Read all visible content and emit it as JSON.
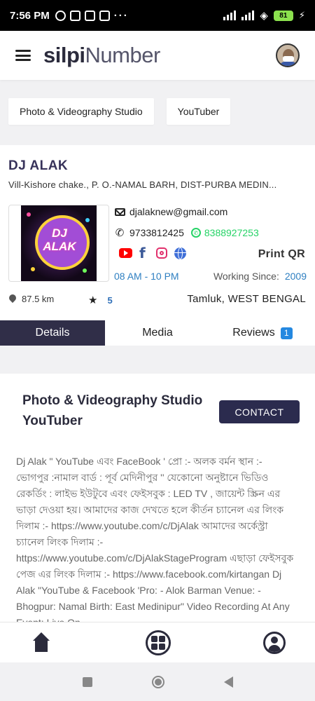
{
  "status_bar": {
    "time": "7:56 PM",
    "more": "···",
    "battery": "81"
  },
  "header": {
    "logo_bold": "silpi",
    "logo_light": "Number"
  },
  "categories": [
    "Photo & Videography Studio",
    "YouTuber"
  ],
  "profile": {
    "name": "DJ ALAK",
    "address": "Vill-Kishore chake., P. O.-NAMAL BARH, DIST-PURBA MEDIN",
    "logo_text": "DJ ALAK",
    "email": "djalaknew@gmail.com",
    "phone": "9733812425",
    "whatsapp": "8388927253",
    "print_qr": "Print QR",
    "hours": "08 AM - 10 PM",
    "working_since_label": "Working Since:",
    "working_since": "2009",
    "distance": "87.5 km",
    "rating": "5",
    "location": "Tamluk, WEST BENGAL",
    "social_icons": [
      "youtube-icon",
      "facebook-icon",
      "instagram-icon",
      "globe-icon"
    ]
  },
  "tabs": [
    {
      "label": "Details",
      "active": true
    },
    {
      "label": "Media",
      "active": false
    },
    {
      "label": "Reviews",
      "active": false,
      "badge": "1"
    }
  ],
  "content": {
    "title_line1": "Photo & Videography Studio",
    "title_line2": "YouTuber",
    "contact_label": "CONTACT",
    "description": "Dj Alak \" YouTube এবং FaceBook ' প্রো :- অলক বর্মন স্থান :- ভোগপুর :নামাল বার্ড : পূর্ব মেদিনীপুর '' যেকোনো অনুষ্টানে ভিডিও রেকর্ডিং : লাইভ ইউটুবে এবং ফেইসবুক : LED TV , জায়েন্ট স্ক্রিন এর ভাড়া দেওয়া হয়। আমাদের কাজ দেখতে হলে কীর্তন চ্যানেল এর লিংক দিলাম :- https://www.youtube.com/c/DjAlak আমাদের অর্কেস্ট্রা চ্যানেল লিংক দিলাম :- https://www.youtube.com/c/DjAlakStageProgram এছাড়া ফেইসবুক পেজ এর লিংক দিলাম :- https://www.facebook.com/kirtangan Dj Alak \"YouTube & Facebook 'Pro: - Alok Barman Venue: - Bhogpur: Namal Birth: East Medinipur\" Video Recording At Any Event: Live On"
  },
  "colors": {
    "accent_dark": "#302e48",
    "link_blue": "#2e7fc1",
    "whatsapp_green": "#25d366",
    "badge_blue": "#2488e0"
  }
}
